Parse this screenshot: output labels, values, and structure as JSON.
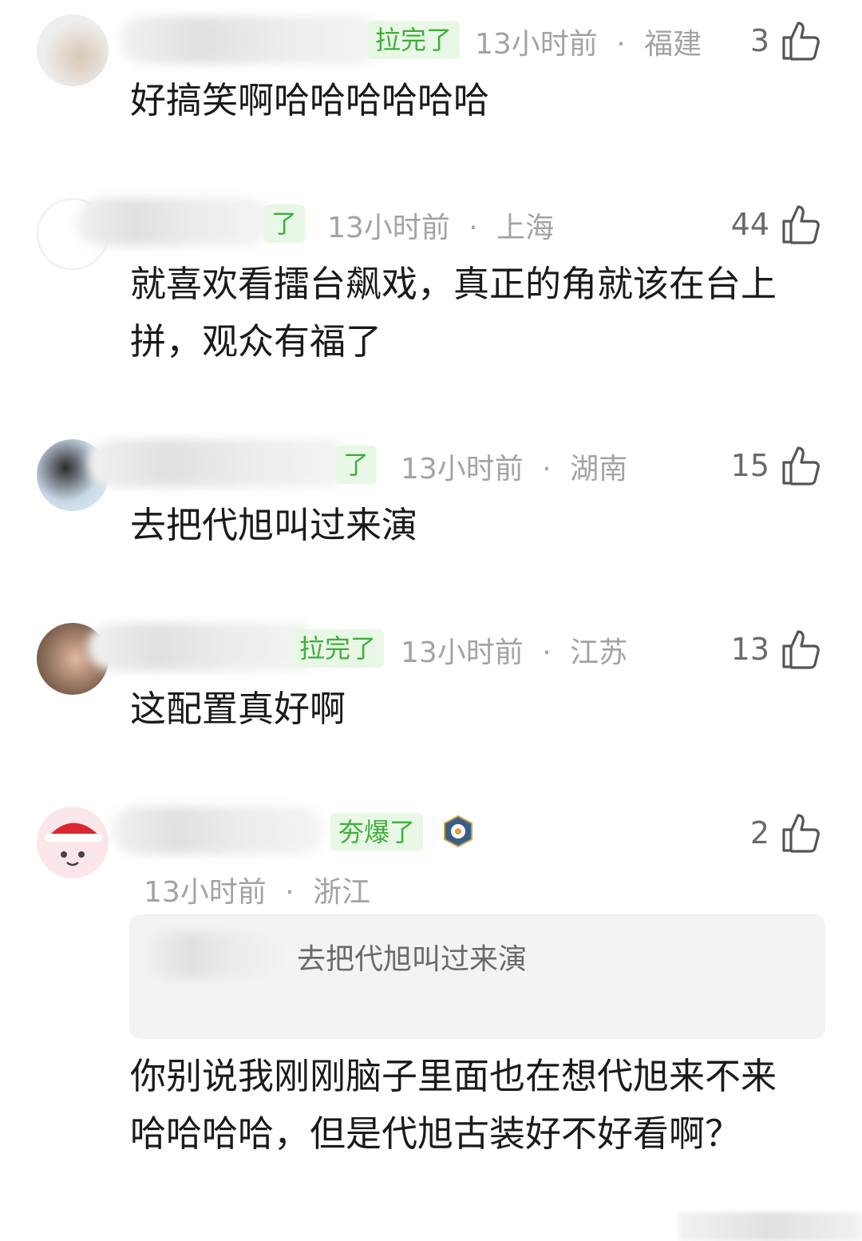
{
  "comments": [
    {
      "badge": "拉完了",
      "time": "13小时前",
      "sep": "·",
      "location": "福建",
      "likes": "3",
      "text": "好搞笑啊哈哈哈哈哈哈"
    },
    {
      "badge": "了",
      "time": "13小时前",
      "sep": "·",
      "location": "上海",
      "likes": "44",
      "text": "就喜欢看擂台飙戏，真正的角就该在台上拼，观众有福了"
    },
    {
      "badge": "了",
      "time": "13小时前",
      "sep": "·",
      "location": "湖南",
      "likes": "15",
      "text": "去把代旭叫过来演"
    },
    {
      "badge": "拉完了",
      "time": "13小时前",
      "sep": "·",
      "location": "江苏",
      "likes": "13",
      "text": "这配置真好啊"
    },
    {
      "badge": "夯爆了",
      "time": "13小时前",
      "sep": "·",
      "location": "浙江",
      "likes": "2",
      "quote": "去把代旭叫过来演",
      "text": "你别说我刚刚脑子里面也在想代旭来不来哈哈哈哈，但是代旭古装好不好看啊？"
    }
  ],
  "icons": {
    "like": "thumbs-up-icon",
    "medal": "medal-icon"
  },
  "colors": {
    "badge_bg": "#e9f7e6",
    "badge_text": "#3fae3a",
    "meta": "#a3a3a3"
  }
}
